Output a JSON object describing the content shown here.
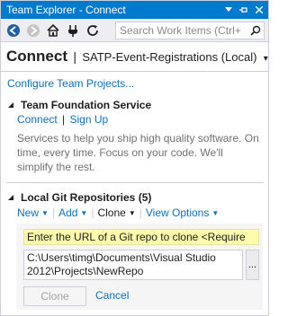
{
  "window": {
    "title": "Team Explorer - Connect",
    "accent_color": "#007acc",
    "title_controls": [
      "dropdown-arrow-icon",
      "pin-icon",
      "close-icon"
    ]
  },
  "toolbar": {
    "buttons": [
      "back-icon",
      "forward-icon",
      "home-icon",
      "connect-icon",
      "refresh-icon"
    ],
    "search_placeholder": "Search Work Items (Ctrl+",
    "search_icon": "search-icon"
  },
  "header": {
    "title": "Connect",
    "separator": "|",
    "subtitle": "SATP-Event-Registrations (Local)"
  },
  "configure_link": "Configure Team Projects...",
  "tfs": {
    "title": "Team Foundation Service",
    "connect_label": "Connect",
    "signup_label": "Sign Up",
    "separator": "|",
    "description": "Services to help you ship high quality software. On time, every time. Focus on your code. We'll simplify the rest."
  },
  "git": {
    "title": "Local Git Repositories (5)",
    "actions": {
      "new_label": "New",
      "add_label": "Add",
      "clone_label": "Clone",
      "view_options_label": "View Options"
    },
    "clone_panel": {
      "url_placeholder": "Enter the URL of a Git repo to clone <Require",
      "path_line1": "C:\\Users\\timg\\Documents\\Visual Studio",
      "path_line2": "2012\\Projects\\NewRepo",
      "browse_label": "...",
      "clone_button": "Clone",
      "cancel_label": "Cancel"
    }
  },
  "colors": {
    "link": "#0e70c0",
    "hint_background": "#fdfbac",
    "muted_text": "#717171"
  }
}
